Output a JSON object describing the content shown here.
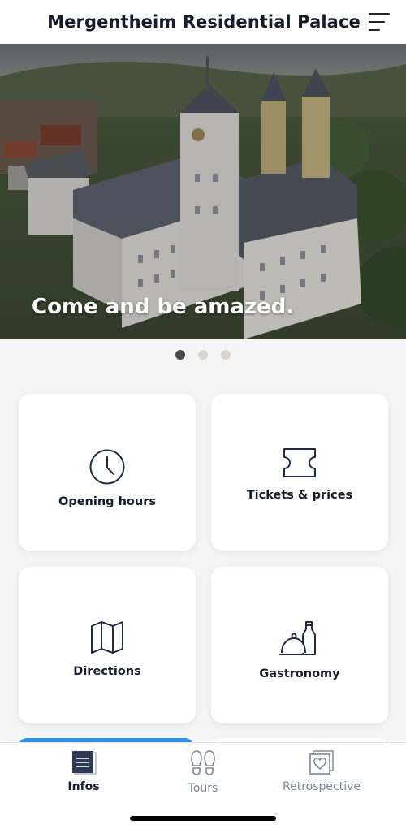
{
  "header": {
    "title": "Mergentheim Residential Palace",
    "menu_icon": "menu-icon"
  },
  "hero": {
    "caption": "Come and be amazed.",
    "slide_count": 3,
    "active_slide": 1
  },
  "tiles": [
    {
      "label": "Opening hours",
      "icon": "clock-icon"
    },
    {
      "label": "Tickets & prices",
      "icon": "ticket-icon"
    },
    {
      "label": "Directions",
      "icon": "map-icon"
    },
    {
      "label": "Gastronomy",
      "icon": "gastronomy-icon"
    }
  ],
  "tab_bar": {
    "tabs": [
      {
        "label": "Infos",
        "icon": "document-icon",
        "active": true
      },
      {
        "label": "Tours",
        "icon": "footprints-icon",
        "active": false
      },
      {
        "label": "Retrospective",
        "icon": "photo-heart-icon",
        "active": false
      }
    ]
  },
  "colors": {
    "text_dark": "#161c2b",
    "tab_inactive": "#7b8594",
    "accent_blue": "#2c8ff0",
    "icon_navy": "#1f2b45"
  }
}
